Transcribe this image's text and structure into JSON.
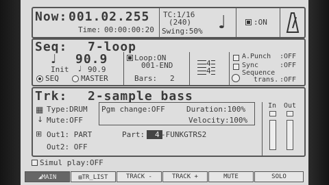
{
  "now": {
    "label": "Now:",
    "position": "001.02.255",
    "time_label": "Time:",
    "time": "00:00:00:20",
    "tc": "TC:1/16",
    "tc_sub": "(240)",
    "swing": "Swing:50%",
    "metronome_state": ":ON"
  },
  "seq": {
    "label": "Seq:",
    "name": "7-loop",
    "tempo": "90.9",
    "init_label": "Init",
    "init_tempo": "90.9",
    "seq_radio": "SEQ",
    "master_radio": "MASTER",
    "loop": "Loop:ON",
    "loop_range": "001-END",
    "bars_label": "Bars:",
    "bars": "2",
    "timesig_top": "4",
    "timesig_bottom": "4",
    "apunch": "A.Punch",
    "apunch_val": ":OFF",
    "sync": "Sync",
    "sync_val": ":OFF",
    "seqtrans1": "Sequence",
    "seqtrans2": "trans.",
    "seqtrans_val": ":OFF"
  },
  "trk": {
    "label": "Trk:",
    "name": "2-sample bass",
    "type": "Type:DRUM",
    "mute": "Mute:OFF",
    "pgm_change": "Pgm change:OFF",
    "duration": "Duration:100%",
    "velocity": "Velocity:100%",
    "out1": "Out1: PART",
    "out2": "Out2: OFF",
    "part_label": "Part:",
    "part_num": "4",
    "part_name": "-FUNKGTRS2",
    "in_label": "In",
    "out_label": "Out",
    "in_level": 0.0,
    "out_level": 0.0
  },
  "simul_play": "Simul play:OFF",
  "tabs": [
    "MAIN",
    "TR_LIST",
    "TRACK -",
    "TRACK +",
    "MUTE",
    "SOLO"
  ]
}
